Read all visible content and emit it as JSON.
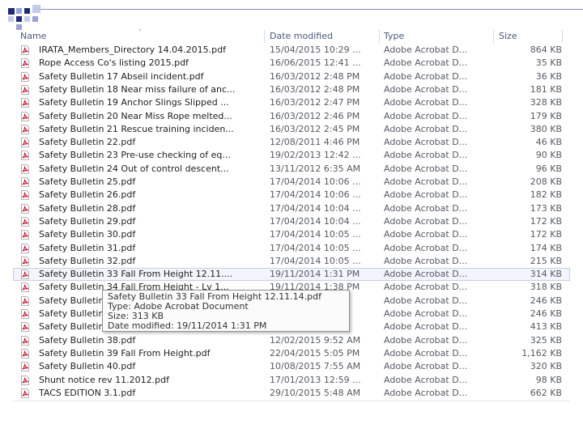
{
  "colors": {
    "accent": "#1f2a7a",
    "pdf_red": "#c8102e",
    "selection": "#c7cfe1"
  },
  "columns": {
    "name": "Name",
    "date": "Date modified",
    "type": "Type",
    "size": "Size"
  },
  "files": [
    {
      "name": "IRATA_Members_Directory 14.04.2015.pdf",
      "date": "15/04/2015 10:29 ...",
      "type": "Adobe Acrobat D...",
      "size": "864 KB",
      "icon": "pdf-icon"
    },
    {
      "name": "Rope Access Co's listing 2015.pdf",
      "date": "16/06/2015 12:41 ...",
      "type": "Adobe Acrobat D...",
      "size": "35 KB",
      "icon": "pdf-icon"
    },
    {
      "name": "Safety Bulletin 17 Abseil incident.pdf",
      "date": "16/03/2012 2:48 PM",
      "type": "Adobe Acrobat D...",
      "size": "36 KB",
      "icon": "pdf-icon"
    },
    {
      "name": "Safety Bulletin 18 Near miss failure of anc...",
      "date": "16/03/2012 2:48 PM",
      "type": "Adobe Acrobat D...",
      "size": "181 KB",
      "icon": "pdf-icon"
    },
    {
      "name": "Safety Bulletin 19 Anchor Slings Slipped ...",
      "date": "16/03/2012 2:47 PM",
      "type": "Adobe Acrobat D...",
      "size": "328 KB",
      "icon": "pdf-icon"
    },
    {
      "name": "Safety Bulletin 20 Near Miss Rope melted...",
      "date": "16/03/2012 2:46 PM",
      "type": "Adobe Acrobat D...",
      "size": "179 KB",
      "icon": "pdf-icon"
    },
    {
      "name": "Safety Bulletin 21 Rescue training inciden...",
      "date": "16/03/2012 2:45 PM",
      "type": "Adobe Acrobat D...",
      "size": "380 KB",
      "icon": "pdf-icon"
    },
    {
      "name": "Safety Bulletin 22.pdf",
      "date": "12/08/2011 4:46 PM",
      "type": "Adobe Acrobat D...",
      "size": "46 KB",
      "icon": "pdf-icon"
    },
    {
      "name": "Safety Bulletin 23 Pre-use checking of eq...",
      "date": "19/02/2013 12:42 ...",
      "type": "Adobe Acrobat D...",
      "size": "90 KB",
      "icon": "pdf-icon"
    },
    {
      "name": "Safety Bulletin 24 Out of control descent...",
      "date": "13/11/2012 6:35 AM",
      "type": "Adobe Acrobat D...",
      "size": "96 KB",
      "icon": "pdf-icon"
    },
    {
      "name": "Safety Bulletin 25.pdf",
      "date": "17/04/2014 10:06 ...",
      "type": "Adobe Acrobat D...",
      "size": "208 KB",
      "icon": "pdf-icon"
    },
    {
      "name": "Safety Bulletin 26.pdf",
      "date": "17/04/2014 10:06 ...",
      "type": "Adobe Acrobat D...",
      "size": "182 KB",
      "icon": "pdf-icon"
    },
    {
      "name": "Safety Bulletin 28.pdf",
      "date": "17/04/2014 10:04 ...",
      "type": "Adobe Acrobat D...",
      "size": "173 KB",
      "icon": "pdf-icon"
    },
    {
      "name": "Safety Bulletin 29.pdf",
      "date": "17/04/2014 10:04 ...",
      "type": "Adobe Acrobat D...",
      "size": "172 KB",
      "icon": "pdf-icon"
    },
    {
      "name": "Safety Bulletin 30.pdf",
      "date": "17/04/2014 10:05 ...",
      "type": "Adobe Acrobat D...",
      "size": "172 KB",
      "icon": "pdf-icon"
    },
    {
      "name": "Safety Bulletin 31.pdf",
      "date": "17/04/2014 10:05 ...",
      "type": "Adobe Acrobat D...",
      "size": "174 KB",
      "icon": "pdf-icon"
    },
    {
      "name": "Safety Bulletin 32.pdf",
      "date": "17/04/2014 10:05 ...",
      "type": "Adobe Acrobat D...",
      "size": "215 KB",
      "icon": "pdf-icon"
    },
    {
      "name": "Safety Bulletin 33 Fall From Height 12.11....",
      "date": "19/11/2014 1:31 PM",
      "type": "Adobe Acrobat D...",
      "size": "314 KB",
      "icon": "pdf-icon",
      "selected": true
    },
    {
      "name": "Safety Bulletin 34 Fall From Height - Lv 1...",
      "date": "19/11/2014 1:38 PM",
      "type": "Adobe Acrobat D...",
      "size": "318 KB",
      "icon": "pdf-icon"
    },
    {
      "name": "Safety Bulletin",
      "date": "",
      "type": "Adobe Acrobat D...",
      "size": "246 KB",
      "icon": "pdf-icon"
    },
    {
      "name": "Safety Bulletin",
      "date": "",
      "type": "Adobe Acrobat D...",
      "size": "246 KB",
      "icon": "pdf-icon"
    },
    {
      "name": "Safety Bulletin",
      "date": "",
      "type": "Adobe Acrobat D...",
      "size": "413 KB",
      "icon": "pdf-icon"
    },
    {
      "name": "Safety Bulletin 38.pdf",
      "date": "12/02/2015 9:52 AM",
      "type": "Adobe Acrobat D...",
      "size": "325 KB",
      "icon": "pdf-icon"
    },
    {
      "name": "Safety Bulletin 39 Fall From Height.pdf",
      "date": "22/04/2015 5:05 PM",
      "type": "Adobe Acrobat D...",
      "size": "1,162 KB",
      "icon": "pdf-icon"
    },
    {
      "name": "Safety Bulletin 40.pdf",
      "date": "10/08/2015 7:55 AM",
      "type": "Adobe Acrobat D...",
      "size": "320 KB",
      "icon": "pdf-icon"
    },
    {
      "name": "Shunt notice rev 11.2012.pdf",
      "date": "17/01/2013 12:59 ...",
      "type": "Adobe Acrobat D...",
      "size": "98 KB",
      "icon": "pdf-icon"
    },
    {
      "name": "TACS EDITION 3.1.pdf",
      "date": "29/10/2015 5:48 AM",
      "type": "Adobe Acrobat D...",
      "size": "662 KB",
      "icon": "pdf-icon"
    }
  ],
  "tooltip": {
    "line1": "Safety Bulletin 33 Fall From Height 12.11.14.pdf",
    "line2": "Type: Adobe Acrobat Document",
    "line3": "Size: 313 KB",
    "line4": "Date modified: 19/11/2014 1:31 PM"
  }
}
